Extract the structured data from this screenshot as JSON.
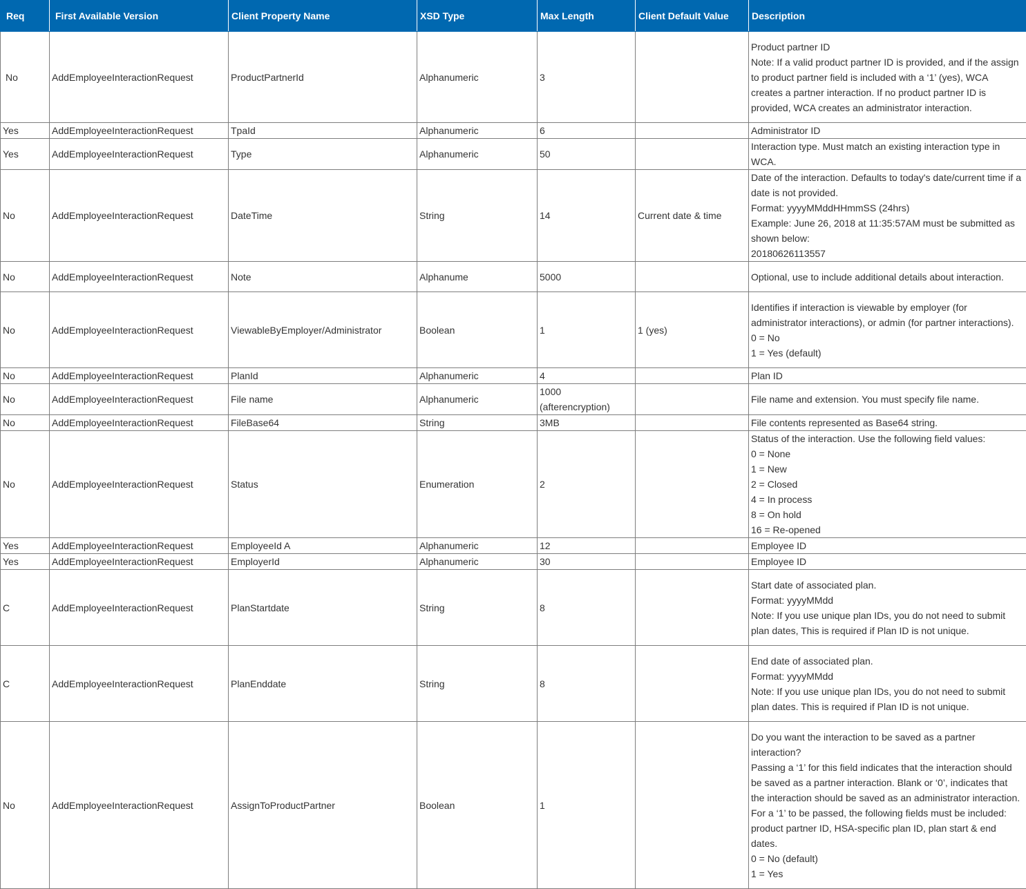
{
  "table": {
    "headers": [
      "Req",
      "First Available Version",
      "Client Property Name",
      "XSD Type",
      "Max Length",
      "Client Default Value",
      "Description"
    ],
    "rows": [
      {
        "req": "No",
        "version": "AddEmployeeInteractionRequest",
        "name": "ProductPartnerId",
        "type": "Alphanumeric",
        "max_length": "3",
        "default": "",
        "description": "Product partner ID\nNote: If a valid product partner ID is provided, and if the assign to product partner field is included with a ‘1’ (yes), WCA creates a partner interaction. If no product partner ID is provided, WCA creates an administrator interaction."
      },
      {
        "req": "Yes",
        "version": "AddEmployeeInteractionRequest",
        "name": "TpaId",
        "type": "Alphanumeric",
        "max_length": "6",
        "default": "",
        "description": "Administrator ID"
      },
      {
        "req": "Yes",
        "version": "AddEmployeeInteractionRequest",
        "name": "Type",
        "type": "Alphanumeric",
        "max_length": "50",
        "default": "",
        "description": "Interaction type. Must match an existing interaction type in WCA."
      },
      {
        "req": "No",
        "version": "AddEmployeeInteractionRequest",
        "name": "DateTime",
        "type": "String",
        "max_length": "14",
        "default": "Current date & time",
        "description": "Date of the interaction. Defaults to today's date/current time if a date is not provided.\nFormat: yyyyMMddHHmmSS (24hrs)\nExample: June 26, 2018 at 11:35:57AM must be submitted as shown below:\n20180626113557"
      },
      {
        "req": "No",
        "version": "AddEmployeeInteractionRequest",
        "name": "Note",
        "type": "Alphanume",
        "max_length": "5000",
        "default": "",
        "description": "Optional, use to include additional details about interaction."
      },
      {
        "req": "No",
        "version": "AddEmployeeInteractionRequest",
        "name": "ViewableByEmployer/Administrator",
        "type": "Boolean",
        "max_length": "1",
        "default": "1 (yes)",
        "description": "Identifies if interaction is viewable by employer (for administrator interactions), or admin (for partner interactions).\n0 = No\n1 = Yes (default)"
      },
      {
        "req": "No",
        "version": "AddEmployeeInteractionRequest",
        "name": "PlanId",
        "type": "Alphanumeric",
        "max_length": "4",
        "default": "",
        "description": "Plan ID"
      },
      {
        "req": "No",
        "version": "AddEmployeeInteractionRequest",
        "name": "File name",
        "type": "Alphanumeric",
        "max_length": "1000\n(afterencryption)",
        "default": "",
        "description": "File name and extension. You must specify file name."
      },
      {
        "req": "No",
        "version": "AddEmployeeInteractionRequest",
        "name": "FileBase64",
        "type": "String",
        "max_length": "3MB",
        "default": "",
        "description": "File contents represented as Base64 string."
      },
      {
        "req": "No",
        "version": "AddEmployeeInteractionRequest",
        "name": "Status",
        "type": "Enumeration",
        "max_length": "2",
        "default": "",
        "description": "Status of the interaction. Use the following field values:\n0 = None\n1 = New\n2 = Closed\n4 = In process\n8 = On hold\n16 = Re-opened"
      },
      {
        "req": "Yes",
        "version": "AddEmployeeInteractionRequest",
        "name": "EmployeeId A",
        "type": "Alphanumeric",
        "max_length": "12",
        "default": "",
        "description": "Employee ID"
      },
      {
        "req": "Yes",
        "version": "AddEmployeeInteractionRequest",
        "name": "EmployerId",
        "type": "Alphanumeric",
        "max_length": "30",
        "default": "",
        "description": "Employee ID"
      },
      {
        "req": "C",
        "version": "AddEmployeeInteractionRequest",
        "name": "PlanStartdate",
        "type": "String",
        "max_length": "8",
        "default": "",
        "description": "Start date of associated plan.\nFormat: yyyyMMdd\nNote: If you use unique plan IDs, you do not need to submit plan dates, This is required if Plan ID is not unique."
      },
      {
        "req": "C",
        "version": "AddEmployeeInteractionRequest",
        "name": "PlanEnddate",
        "type": "String",
        "max_length": "8",
        "default": "",
        "description": "End date of associated plan.\nFormat: yyyyMMdd\nNote: If you use unique plan IDs, you do not need to submit plan dates. This is required if Plan ID is not unique."
      },
      {
        "req": "No",
        "version": "AddEmployeeInteractionRequest",
        "name": "AssignToProductPartner",
        "type": "Boolean",
        "max_length": "1",
        "default": "",
        "description": "Do you want the interaction to be saved as a partner interaction?\nPassing a ‘1’ for this field indicates that the interaction should be saved as a partner interaction. Blank or ‘0’, indicates that the interaction should be saved as an administrator interaction.\nFor a ‘1’ to be passed, the following fields must be included: product partner ID, HSA-specific plan ID, plan start & end dates.\n0 = No (default)\n1 = Yes"
      }
    ]
  }
}
